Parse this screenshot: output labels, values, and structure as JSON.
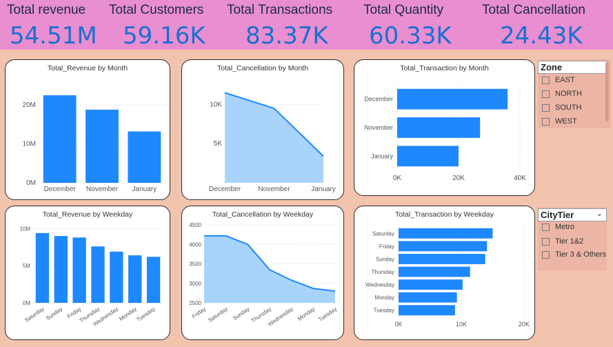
{
  "kpis": [
    {
      "label": "Total revenue",
      "value": "54.51M"
    },
    {
      "label": "Total Customers",
      "value": "59.16K"
    },
    {
      "label": "Total Transactions",
      "value": "83.37K"
    },
    {
      "label": "Total Quantity",
      "value": "60.33K"
    },
    {
      "label": "Total Cancellation",
      "value": "24.43K"
    }
  ],
  "slicers": {
    "zone": {
      "title": "Zone",
      "items": [
        "EAST",
        "NORTH",
        "SOUTH",
        "WEST"
      ]
    },
    "citytier": {
      "title": "CityTier",
      "items": [
        "Metro",
        "Tier 1&2",
        "Tier 3 & Others"
      ]
    }
  },
  "colors": {
    "bar": "#1e88ff",
    "area_fill": "#a8d3fb",
    "area_line": "#1e88ff",
    "kpi_bg": "#e98ed0",
    "kpi_value": "#1a6fd1",
    "page_bg": "#f2c3ad"
  },
  "chart_data": [
    {
      "id": "rev_month",
      "type": "bar",
      "title": "Total_Revenue by Month",
      "categories": [
        "December",
        "November",
        "January"
      ],
      "values": [
        22.5,
        18.8,
        13.2
      ],
      "yticks": [
        "0M",
        "10M",
        "20M"
      ],
      "ylim": [
        0,
        25
      ]
    },
    {
      "id": "canc_month",
      "type": "area",
      "title": "Total_Cancellation by Month",
      "categories": [
        "December",
        "November",
        "January"
      ],
      "values": [
        11500,
        9500,
        3400
      ],
      "yticks": [
        "5K",
        "10K"
      ],
      "ylim": [
        0,
        12500
      ]
    },
    {
      "id": "trans_month",
      "type": "hbar",
      "title": "Total_Transaction by Month",
      "categories": [
        "December",
        "November",
        "January"
      ],
      "values": [
        36000,
        27000,
        20000
      ],
      "xticks": [
        "0K",
        "20K",
        "40K"
      ],
      "xlim": [
        0,
        40000
      ]
    },
    {
      "id": "rev_weekday",
      "type": "bar",
      "title": "Total_Revenue by Weekday",
      "categories": [
        "Saturday",
        "Sunday",
        "Friday",
        "Thursday",
        "Wednesday",
        "Monday",
        "Tuesday"
      ],
      "values": [
        9.4,
        9.0,
        8.8,
        7.6,
        6.9,
        6.4,
        6.2
      ],
      "yticks": [
        "0M",
        "5M",
        "10M"
      ],
      "ylim": [
        0,
        10.5
      ]
    },
    {
      "id": "canc_weekday",
      "type": "area",
      "title": "Total_Cancellation by Weekday",
      "categories": [
        "Friday",
        "Saturday",
        "Sunday",
        "Thursday",
        "Wednesday",
        "Monday",
        "Tuesday"
      ],
      "values": [
        4220,
        4220,
        4000,
        3350,
        3080,
        2870,
        2800
      ],
      "yticks": [
        "2500",
        "3000",
        "3500",
        "4000",
        "4500"
      ],
      "ylim": [
        2500,
        4500
      ]
    },
    {
      "id": "trans_weekday",
      "type": "hbar",
      "title": "Total_Transaction by Weekday",
      "categories": [
        "Saturday",
        "Friday",
        "Sunday",
        "Thursday",
        "Wednesday",
        "Monday",
        "Tuesday"
      ],
      "values": [
        15000,
        14100,
        13800,
        11400,
        10200,
        9300,
        9000
      ],
      "xticks": [
        "0K",
        "10K",
        "20K"
      ],
      "xlim": [
        0,
        20000
      ]
    }
  ]
}
